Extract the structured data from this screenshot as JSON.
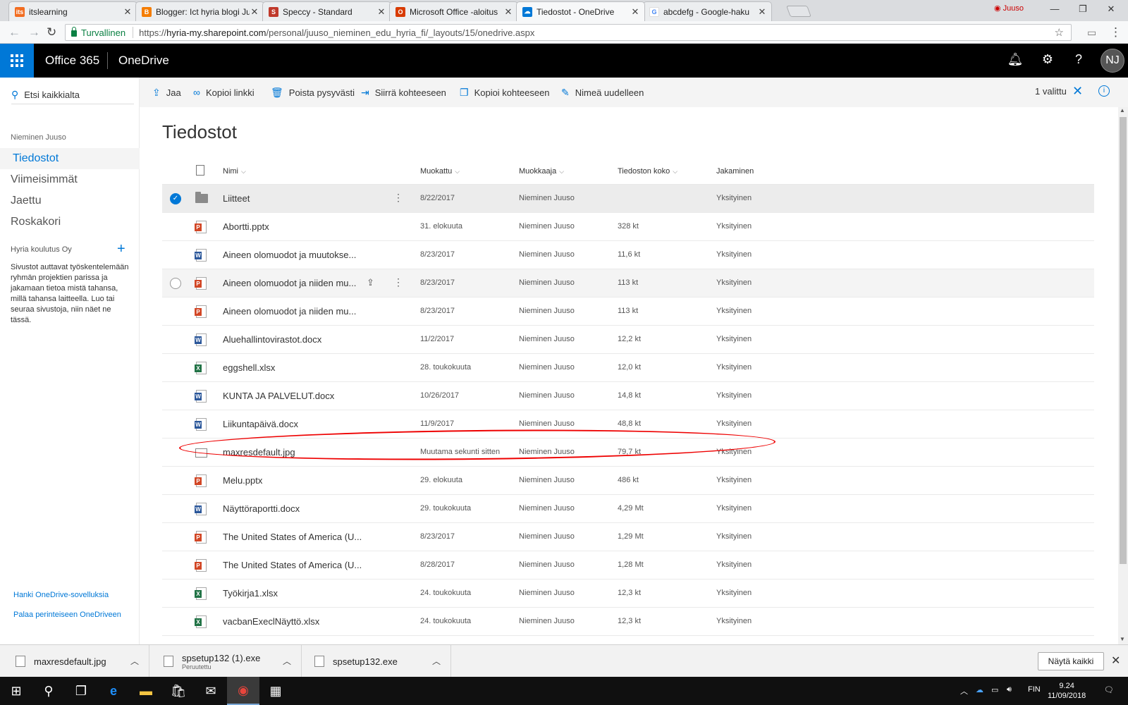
{
  "browser": {
    "tabs": [
      {
        "title": "itslearning",
        "icon": "itslearning-icon",
        "color": "#f26d21"
      },
      {
        "title": "Blogger: Ict hyria blogi Ju",
        "icon": "blogger-icon",
        "color": "#f57d00"
      },
      {
        "title": "Speccy - Standard",
        "icon": "speccy-icon",
        "color": "#c0392b"
      },
      {
        "title": "Microsoft Office -aloitus",
        "icon": "office-icon",
        "color": "#d83b01"
      },
      {
        "title": "Tiedostot - OneDrive",
        "icon": "onedrive-icon",
        "color": "#0078d7"
      },
      {
        "title": "abcdefg - Google-haku",
        "icon": "google-icon",
        "color": "#4285f4"
      }
    ],
    "profile_name": "Juuso",
    "secure_label": "Turvallinen",
    "url_prefix": "https://",
    "url_host": "hyria-my.sharepoint.com",
    "url_path": "/personal/juuso_nieminen_edu_hyria_fi/_layouts/15/onedrive.aspx"
  },
  "header": {
    "brand": "Office 365",
    "app": "OneDrive",
    "avatar_initials": "NJ"
  },
  "leftnav": {
    "search_placeholder": "Etsi kaikkialta",
    "owner": "Nieminen Juuso",
    "items": [
      {
        "label": "Tiedostot"
      },
      {
        "label": "Viimeisimmät"
      },
      {
        "label": "Jaettu"
      },
      {
        "label": "Roskakori"
      }
    ],
    "org": "Hyria koulutus Oy",
    "sites_info": "Sivustot auttavat työskentelemään ryhmän projektien parissa ja jakamaan tietoa mistä tahansa, millä tahansa laitteella. Luo tai seuraa sivustoja, niin näet ne tässä.",
    "get_apps": "Hanki OneDrive-sovelluksia",
    "classic": "Palaa perinteiseen OneDriveen"
  },
  "commandbar": {
    "share": "Jaa",
    "copy_link": "Kopioi linkki",
    "delete": "Poista pysyvästi",
    "move": "Siirrä kohteeseen",
    "copy": "Kopioi kohteeseen",
    "rename": "Nimeä uudelleen",
    "selected": "1 valittu"
  },
  "main": {
    "title": "Tiedostot",
    "columns": {
      "name": "Nimi",
      "modified": "Muokattu",
      "modified_by": "Muokkaaja",
      "size": "Tiedoston koko",
      "sharing": "Jakaminen"
    },
    "files": [
      {
        "name": "Liitteet",
        "type": "folder",
        "modified": "8/22/2017",
        "by": "Nieminen Juuso",
        "size": "",
        "sharing": "Yksityinen"
      },
      {
        "name": "Abortti.pptx",
        "type": "pptx",
        "modified": "31. elokuuta",
        "by": "Nieminen Juuso",
        "size": "328 kt",
        "sharing": "Yksityinen"
      },
      {
        "name": "Aineen olomuodot ja muutokse...",
        "type": "docx",
        "modified": "8/23/2017",
        "by": "Nieminen Juuso",
        "size": "11,6 kt",
        "sharing": "Yksityinen"
      },
      {
        "name": "Aineen olomuodot ja niiden mu...",
        "type": "pptx",
        "modified": "8/23/2017",
        "by": "Nieminen Juuso",
        "size": "113 kt",
        "sharing": "Yksityinen"
      },
      {
        "name": "Aineen olomuodot ja niiden mu...",
        "type": "pptx",
        "modified": "8/23/2017",
        "by": "Nieminen Juuso",
        "size": "113 kt",
        "sharing": "Yksityinen"
      },
      {
        "name": "Aluehallintovirastot.docx",
        "type": "docx",
        "modified": "11/2/2017",
        "by": "Nieminen Juuso",
        "size": "12,2 kt",
        "sharing": "Yksityinen"
      },
      {
        "name": "eggshell.xlsx",
        "type": "xlsx",
        "modified": "28. toukokuuta",
        "by": "Nieminen Juuso",
        "size": "12,0 kt",
        "sharing": "Yksityinen"
      },
      {
        "name": "KUNTA JA PALVELUT.docx",
        "type": "docx",
        "modified": "10/26/2017",
        "by": "Nieminen Juuso",
        "size": "14,8 kt",
        "sharing": "Yksityinen"
      },
      {
        "name": "Liikuntapäivä.docx",
        "type": "docx",
        "modified": "11/9/2017",
        "by": "Nieminen Juuso",
        "size": "48,8 kt",
        "sharing": "Yksityinen"
      },
      {
        "name": "maxresdefault.jpg",
        "type": "jpg",
        "modified": "Muutama sekunti sitten",
        "by": "Nieminen Juuso",
        "size": "79,7 kt",
        "sharing": "Yksityinen"
      },
      {
        "name": "Melu.pptx",
        "type": "pptx",
        "modified": "29. elokuuta",
        "by": "Nieminen Juuso",
        "size": "486 kt",
        "sharing": "Yksityinen"
      },
      {
        "name": "Näyttöraportti.docx",
        "type": "docx",
        "modified": "29. toukokuuta",
        "by": "Nieminen Juuso",
        "size": "4,29 Mt",
        "sharing": "Yksityinen"
      },
      {
        "name": "The United States of America (U...",
        "type": "pptx",
        "modified": "8/23/2017",
        "by": "Nieminen Juuso",
        "size": "1,29 Mt",
        "sharing": "Yksityinen"
      },
      {
        "name": "The United States of America (U...",
        "type": "pptx",
        "modified": "8/28/2017",
        "by": "Nieminen Juuso",
        "size": "1,28 Mt",
        "sharing": "Yksityinen"
      },
      {
        "name": "Työkirja1.xlsx",
        "type": "xlsx",
        "modified": "24. toukokuuta",
        "by": "Nieminen Juuso",
        "size": "12,3 kt",
        "sharing": "Yksityinen"
      },
      {
        "name": "vacbanExeclNäyttö.xlsx",
        "type": "xlsx",
        "modified": "24. toukokuuta",
        "by": "Nieminen Juuso",
        "size": "12,3 kt",
        "sharing": "Yksityinen"
      }
    ]
  },
  "downloads": {
    "items": [
      {
        "name": "maxresdefault.jpg",
        "status": ""
      },
      {
        "name": "spsetup132 (1).exe",
        "status": "Peruutettu"
      },
      {
        "name": "spsetup132.exe",
        "status": ""
      }
    ],
    "show_all": "Näytä kaikki"
  },
  "taskbar": {
    "lang": "FIN",
    "time": "9.24",
    "date": "11/09/2018"
  },
  "colors": {
    "accent": "#0078d7",
    "word": "#2b579a",
    "excel": "#217346",
    "powerpoint": "#d24726",
    "annotation": "#e00000"
  }
}
